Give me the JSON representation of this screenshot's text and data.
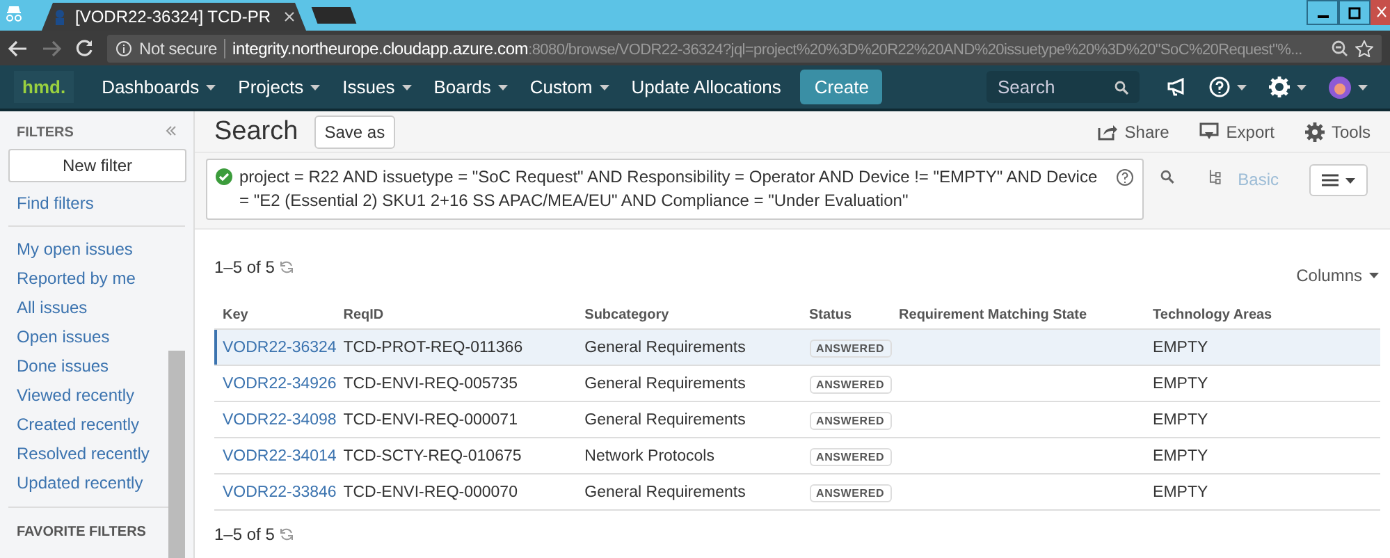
{
  "browser": {
    "tab_title": "[VODR22-36324] TCD-PR",
    "security": "Not secure",
    "host": "integrity.northeurope.cloudapp.azure.com",
    "path": ":8080/browse/VODR22-36324?jql=project%20%3D%20R22%20AND%20issuetype%20%3D%20\"SoC%20Request\"%..."
  },
  "nav": {
    "logo": "hmd.",
    "menus": [
      {
        "label": "Dashboards",
        "dropdown": true
      },
      {
        "label": "Projects",
        "dropdown": true
      },
      {
        "label": "Issues",
        "dropdown": true
      },
      {
        "label": "Boards",
        "dropdown": true
      },
      {
        "label": "Custom",
        "dropdown": true
      },
      {
        "label": "Update Allocations",
        "dropdown": false
      }
    ],
    "create": "Create",
    "search": {
      "placeholder": "Search"
    }
  },
  "sidebar": {
    "title": "FILTERS",
    "new_filter": "New filter",
    "find_filters": "Find filters",
    "items": [
      "My open issues",
      "Reported by me",
      "All issues",
      "Open issues",
      "Done issues",
      "Viewed recently",
      "Created recently",
      "Resolved recently",
      "Updated recently"
    ],
    "section": "FAVORITE FILTERS"
  },
  "search": {
    "title": "Search",
    "save_as": "Save as",
    "actions": [
      {
        "kind": "share",
        "label": "Share"
      },
      {
        "kind": "export",
        "label": "Export"
      },
      {
        "kind": "tools",
        "label": "Tools"
      }
    ],
    "query": {
      "valid": true,
      "text": "project = R22 AND issuetype = \"SoC Request\" AND Responsibility = Operator AND Device != \"EMPTY\" AND Device = \"E2 (Essential 2) SKU1 2+16 SS APAC/MEA/EU\" AND Compliance = \"Under Evaluation\""
    },
    "mode": "Basic"
  },
  "results": {
    "count_top": "1–5 of 5",
    "columns_button": "Columns",
    "count_bottom": "1–5 of 5"
  },
  "table": {
    "columns": [
      "Key",
      "ReqID",
      "Subcategory",
      "Status",
      "Requirement Matching State",
      "Technology Areas"
    ],
    "rows": [
      {
        "key": "VODR22-36324",
        "reqid": "TCD-PROT-REQ-011366",
        "subcategory": "General Requirements",
        "status": "ANSWERED",
        "technology_areas": "EMPTY",
        "selected": true
      },
      {
        "key": "VODR22-34926",
        "reqid": "TCD-ENVI-REQ-005735",
        "subcategory": "General Requirements",
        "status": "ANSWERED",
        "technology_areas": "EMPTY",
        "selected": false
      },
      {
        "key": "VODR22-34098",
        "reqid": "TCD-ENVI-REQ-000071",
        "subcategory": "General Requirements",
        "status": "ANSWERED",
        "technology_areas": "EMPTY",
        "selected": false
      },
      {
        "key": "VODR22-34014",
        "reqid": "TCD-SCTY-REQ-010675",
        "subcategory": "Network Protocols",
        "status": "ANSWERED",
        "technology_areas": "EMPTY",
        "selected": false
      },
      {
        "key": "VODR22-33846",
        "reqid": "TCD-ENVI-REQ-000070",
        "subcategory": "General Requirements",
        "status": "ANSWERED",
        "technology_areas": "EMPTY",
        "selected": false
      }
    ]
  }
}
